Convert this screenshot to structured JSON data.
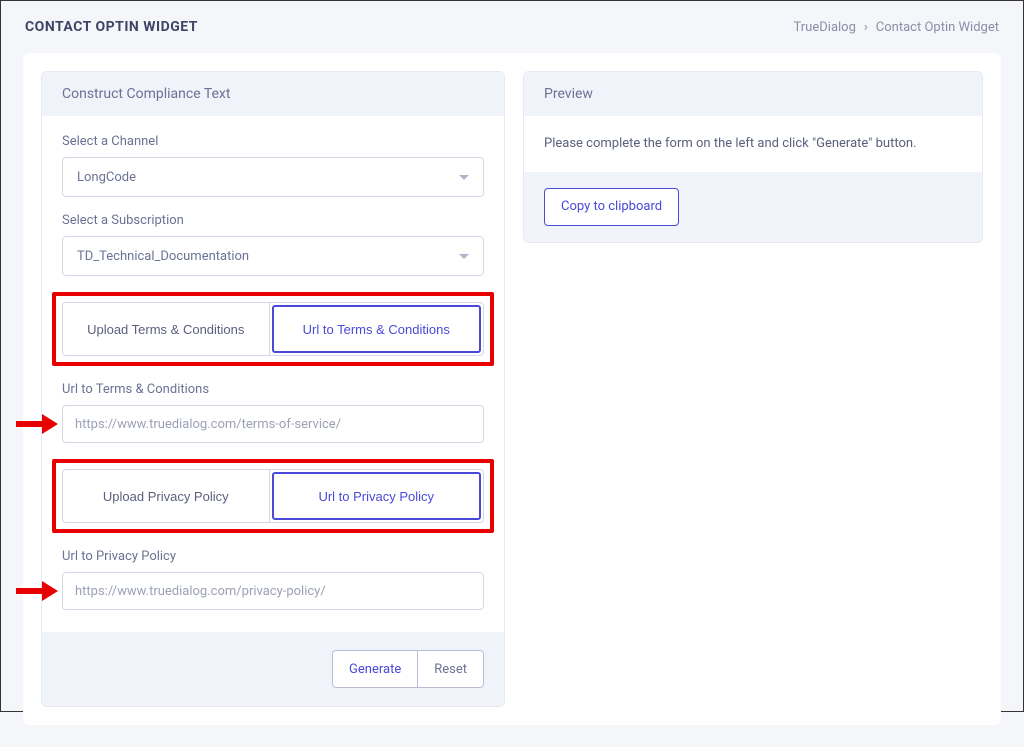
{
  "header": {
    "title": "CONTACT OPTIN WIDGET",
    "breadcrumb": {
      "root": "TrueDialog",
      "current": "Contact Optin Widget"
    }
  },
  "form": {
    "card_title": "Construct Compliance Text",
    "channel": {
      "label": "Select a Channel",
      "value": "LongCode"
    },
    "subscription": {
      "label": "Select a Subscription",
      "value": "TD_Technical_Documentation"
    },
    "terms_toggle": {
      "upload": "Upload Terms & Conditions",
      "url": "Url to Terms & Conditions"
    },
    "terms_url": {
      "label": "Url to Terms & Conditions",
      "value": "https://www.truedialog.com/terms-of-service/"
    },
    "privacy_toggle": {
      "upload": "Upload Privacy Policy",
      "url": "Url to Privacy Policy"
    },
    "privacy_url": {
      "label": "Url to Privacy Policy",
      "value": "https://www.truedialog.com/privacy-policy/"
    },
    "generate_label": "Generate",
    "reset_label": "Reset"
  },
  "preview": {
    "card_title": "Preview",
    "placeholder_text": "Please complete the form on the left and click \"Generate\" button.",
    "copy_label": "Copy to clipboard"
  }
}
